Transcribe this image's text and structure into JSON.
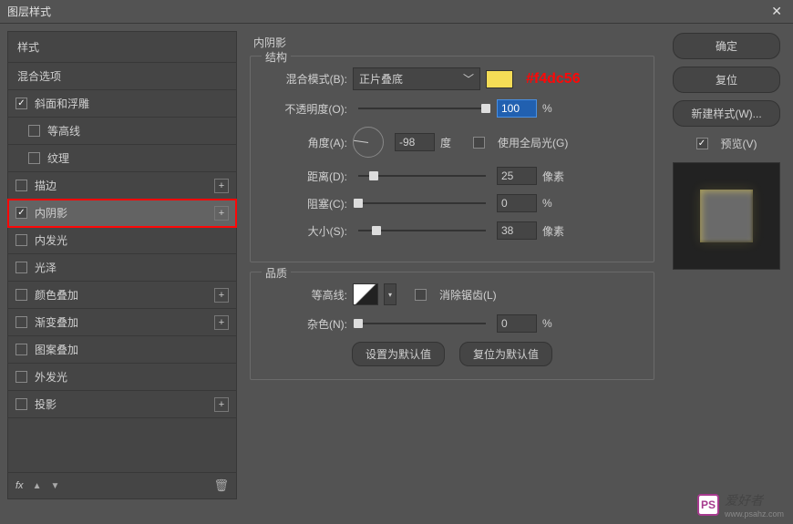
{
  "window": {
    "title": "图层样式"
  },
  "sidebar": {
    "header": "样式",
    "blend": "混合选项",
    "items": [
      {
        "label": "斜面和浮雕",
        "checked": true,
        "indent": false,
        "plus": false
      },
      {
        "label": "等高线",
        "checked": false,
        "indent": true,
        "plus": false
      },
      {
        "label": "纹理",
        "checked": false,
        "indent": true,
        "plus": false
      },
      {
        "label": "描边",
        "checked": false,
        "indent": false,
        "plus": true
      },
      {
        "label": "内阴影",
        "checked": true,
        "indent": false,
        "plus": true,
        "selected": true
      },
      {
        "label": "内发光",
        "checked": false,
        "indent": false,
        "plus": false
      },
      {
        "label": "光泽",
        "checked": false,
        "indent": false,
        "plus": false
      },
      {
        "label": "颜色叠加",
        "checked": false,
        "indent": false,
        "plus": true
      },
      {
        "label": "渐变叠加",
        "checked": false,
        "indent": false,
        "plus": true
      },
      {
        "label": "图案叠加",
        "checked": false,
        "indent": false,
        "plus": false
      },
      {
        "label": "外发光",
        "checked": false,
        "indent": false,
        "plus": false
      },
      {
        "label": "投影",
        "checked": false,
        "indent": false,
        "plus": true
      }
    ],
    "fx": "fx"
  },
  "panel": {
    "title": "内阴影",
    "structure": {
      "title": "结构",
      "blend_mode_label": "混合模式(B):",
      "blend_mode_value": "正片叠底",
      "color_annot": "#f4dc56",
      "opacity_label": "不透明度(O):",
      "opacity_value": "100",
      "opacity_unit": "%",
      "angle_label": "角度(A):",
      "angle_value": "-98",
      "angle_unit": "度",
      "global_light": "使用全局光(G)",
      "distance_label": "距离(D):",
      "distance_value": "25",
      "distance_unit": "像素",
      "choke_label": "阻塞(C):",
      "choke_value": "0",
      "choke_unit": "%",
      "size_label": "大小(S):",
      "size_value": "38",
      "size_unit": "像素"
    },
    "quality": {
      "title": "品质",
      "contour_label": "等高线:",
      "antialias": "消除锯齿(L)",
      "noise_label": "杂色(N):",
      "noise_value": "0",
      "noise_unit": "%"
    },
    "defaults_set": "设置为默认值",
    "defaults_reset": "复位为默认值"
  },
  "right": {
    "ok": "确定",
    "cancel": "复位",
    "new_style": "新建样式(W)...",
    "preview": "预览(V)"
  },
  "watermark": {
    "badge": "PS",
    "text": "爱好者",
    "sub": "www.psahz.com"
  }
}
